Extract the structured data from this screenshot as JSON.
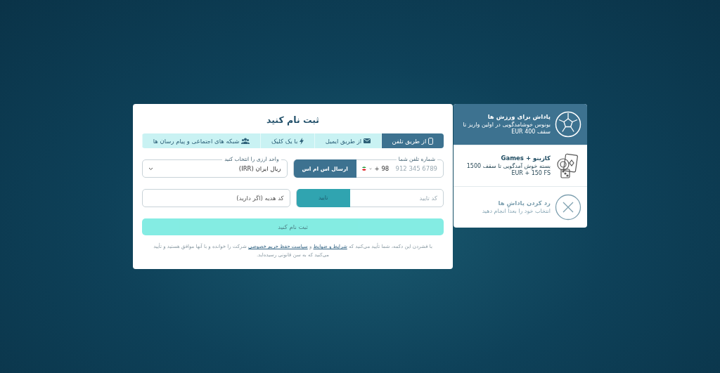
{
  "form": {
    "title": "ثبت نام کنید",
    "tabs": [
      {
        "label": "از طریق تلفن",
        "kind": "phone",
        "selected": true
      },
      {
        "label": "از طریق ایمیل",
        "kind": "mail",
        "selected": false
      },
      {
        "label": "با یک کلیک",
        "kind": "bolt",
        "selected": false
      },
      {
        "label": "شبکه های اجتماعی و پیام رسان ها",
        "kind": "users",
        "selected": false
      }
    ],
    "phone": {
      "label": "شماره تلفن شما",
      "code": "+ 98",
      "placeholder": "912 345 6789",
      "button": "ارسال اس ام اس"
    },
    "currency": {
      "label": "واحد ارزی را انتخاب کنید",
      "value": "ریال ایران (IRR)"
    },
    "confirm": {
      "placeholder": "کد تایید",
      "button": "تایید",
      "disabled": true
    },
    "promo": {
      "placeholder": "کد هدیه (اگر دارید)"
    },
    "submit": {
      "label": "ثبت نام کنید",
      "disabled": true
    },
    "disclaimer": [
      {
        "kind": "text",
        "text": "با فشردن این دکمه، شما تأیید می‌کنید که"
      },
      {
        "kind": "link",
        "text": "شرایط و ضوابط"
      },
      {
        "kind": "text",
        "text": "و"
      },
      {
        "kind": "link",
        "text": "سیاست حفظ حریم خصوصی"
      },
      {
        "kind": "text",
        "text": "شرکت را خوانده و با آنها موافق هستید و تأیید می‌کنید که به سن قانونی رسیده‌اید."
      }
    ]
  },
  "bonuses": [
    {
      "kind": "sport",
      "title": "پاداش برای ورزش ها",
      "text": "بونوس خوشامدگویی در اولین واریز تا سقف EUR 400",
      "selected": true
    },
    {
      "kind": "casino",
      "title": "کازینو + Games",
      "text": "بسته خوش آمدگویی تا سقف 1500 EUR + 150 FS",
      "selected": false
    },
    {
      "kind": "reject",
      "title": "رد کردن پاداش ها",
      "text": "انتخاب خود را بعداً انجام دهید",
      "selected": false
    }
  ]
}
